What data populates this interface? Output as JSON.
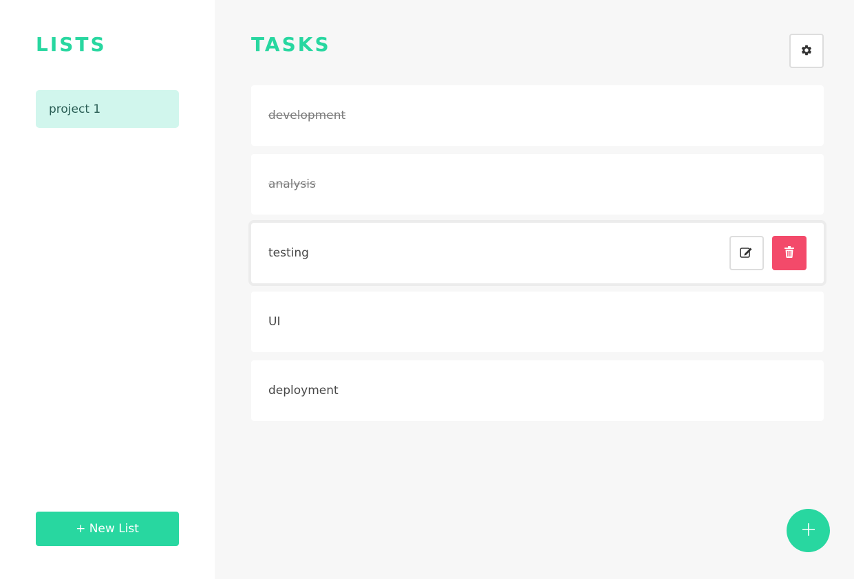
{
  "sidebar": {
    "title": "LISTS",
    "lists": [
      {
        "label": "project 1",
        "selected": true
      }
    ],
    "new_list_label": "+ New List"
  },
  "main": {
    "title": "TASKS",
    "tasks": [
      {
        "label": "development",
        "completed": true
      },
      {
        "label": "analysis",
        "completed": true
      },
      {
        "label": "testing",
        "completed": false
      },
      {
        "label": "UI",
        "completed": false
      },
      {
        "label": "deployment",
        "completed": false
      }
    ]
  },
  "icons": {
    "settings": "gear-icon",
    "edit": "edit-icon",
    "delete": "trash-icon",
    "add": "plus-icon"
  },
  "colors": {
    "accent": "#28d7a0",
    "selected_list_bg": "#d1f6ed",
    "danger": "#f34a6a",
    "main_bg": "#f7f7f7"
  }
}
